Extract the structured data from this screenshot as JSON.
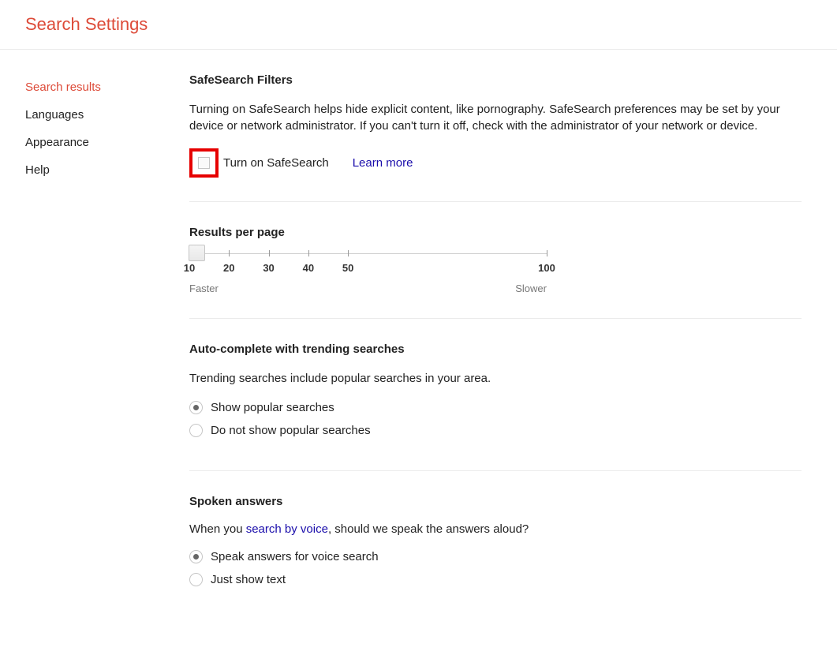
{
  "header": {
    "title": "Search Settings"
  },
  "sidebar": {
    "items": [
      {
        "label": "Search results",
        "active": true
      },
      {
        "label": "Languages",
        "active": false
      },
      {
        "label": "Appearance",
        "active": false
      },
      {
        "label": "Help",
        "active": false
      }
    ]
  },
  "safesearch": {
    "title": "SafeSearch Filters",
    "description": "Turning on SafeSearch helps hide explicit content, like pornography. SafeSearch preferences may be set by your device or network administrator. If you can't turn it off, check with the administrator of your network or device.",
    "checkbox_label": "Turn on SafeSearch",
    "learn_more": "Learn more",
    "checked": false
  },
  "results_per_page": {
    "title": "Results per page",
    "ticks": [
      "10",
      "20",
      "30",
      "40",
      "50",
      "100"
    ],
    "value": "10",
    "faster_label": "Faster",
    "slower_label": "Slower"
  },
  "autocomplete": {
    "title": "Auto-complete with trending searches",
    "description": "Trending searches include popular searches in your area.",
    "options": [
      {
        "label": "Show popular searches",
        "selected": true
      },
      {
        "label": "Do not show popular searches",
        "selected": false
      }
    ]
  },
  "spoken": {
    "title": "Spoken answers",
    "desc_prefix": "When you ",
    "desc_link": "search by voice",
    "desc_suffix": ", should we speak the answers aloud?",
    "options": [
      {
        "label": "Speak answers for voice search",
        "selected": true
      },
      {
        "label": "Just show text",
        "selected": false
      }
    ]
  }
}
